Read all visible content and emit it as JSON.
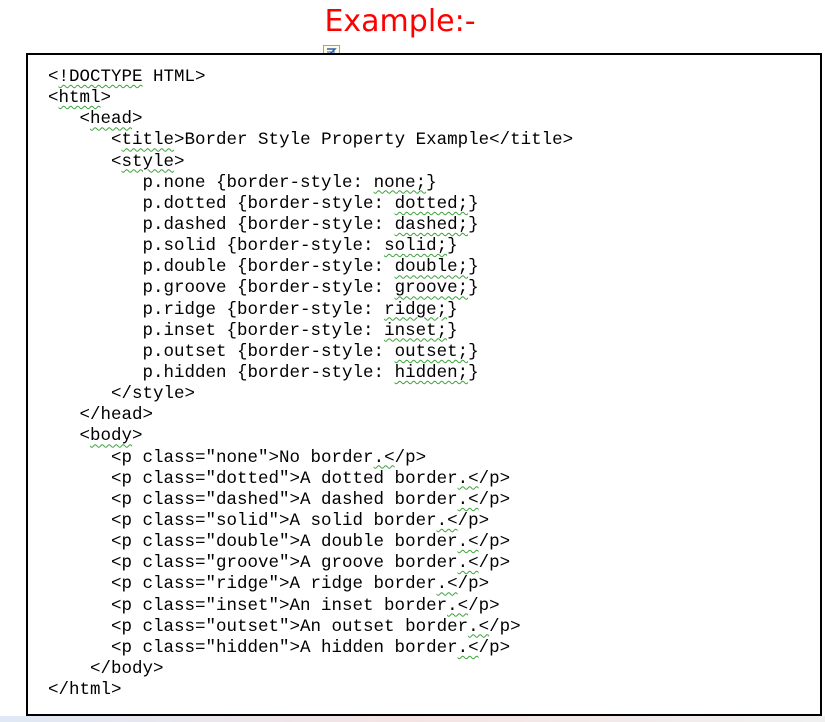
{
  "heading": "Example:-",
  "code_lines": [
    {
      "indent": "",
      "parts": [
        {
          "t": "<"
        },
        {
          "t": "!DOCTYPE",
          "sq": true
        },
        {
          "t": " HTML>"
        }
      ]
    },
    {
      "indent": "",
      "parts": [
        {
          "t": "<"
        },
        {
          "t": "html",
          "sq": true
        },
        {
          "t": ">"
        }
      ]
    },
    {
      "indent": "   ",
      "parts": [
        {
          "t": "<"
        },
        {
          "t": "head",
          "sq": true
        },
        {
          "t": ">"
        }
      ]
    },
    {
      "indent": "      ",
      "parts": [
        {
          "t": "<"
        },
        {
          "t": "title",
          "sq": true
        },
        {
          "t": ">Border Style Property Example</title>"
        }
      ]
    },
    {
      "indent": "      ",
      "parts": [
        {
          "t": "<"
        },
        {
          "t": "style",
          "sq": true
        },
        {
          "t": ">"
        }
      ]
    },
    {
      "indent": "         ",
      "parts": [
        {
          "t": "p.none {border-style: "
        },
        {
          "t": "none;",
          "sq": true
        },
        {
          "t": "}"
        }
      ]
    },
    {
      "indent": "         ",
      "parts": [
        {
          "t": "p.dotted {border-style: "
        },
        {
          "t": "dotted;",
          "sq": true
        },
        {
          "t": "}"
        }
      ]
    },
    {
      "indent": "         ",
      "parts": [
        {
          "t": "p.dashed {border-style: "
        },
        {
          "t": "dashed;",
          "sq": true
        },
        {
          "t": "}"
        }
      ]
    },
    {
      "indent": "         ",
      "parts": [
        {
          "t": "p.solid {border-style: "
        },
        {
          "t": "solid;",
          "sq": true
        },
        {
          "t": "}"
        }
      ]
    },
    {
      "indent": "         ",
      "parts": [
        {
          "t": "p.double {border-style: "
        },
        {
          "t": "double;",
          "sq": true
        },
        {
          "t": "}"
        }
      ]
    },
    {
      "indent": "         ",
      "parts": [
        {
          "t": "p.groove {border-style: "
        },
        {
          "t": "groove;",
          "sq": true
        },
        {
          "t": "}"
        }
      ]
    },
    {
      "indent": "         ",
      "parts": [
        {
          "t": "p.ridge {border-style: "
        },
        {
          "t": "ridge;",
          "sq": true
        },
        {
          "t": "}"
        }
      ]
    },
    {
      "indent": "         ",
      "parts": [
        {
          "t": "p.inset {border-style: "
        },
        {
          "t": "inset;",
          "sq": true
        },
        {
          "t": "}"
        }
      ]
    },
    {
      "indent": "         ",
      "parts": [
        {
          "t": "p.outset {border-style: "
        },
        {
          "t": "outset;",
          "sq": true
        },
        {
          "t": "}"
        }
      ]
    },
    {
      "indent": "         ",
      "parts": [
        {
          "t": "p.hidden {border-style: "
        },
        {
          "t": "hidden;",
          "sq": true
        },
        {
          "t": "}"
        }
      ]
    },
    {
      "indent": "      ",
      "parts": [
        {
          "t": "</style>"
        }
      ]
    },
    {
      "indent": "   ",
      "parts": [
        {
          "t": "</head>"
        }
      ]
    },
    {
      "indent": "   ",
      "parts": [
        {
          "t": "<"
        },
        {
          "t": "body",
          "sq": true
        },
        {
          "t": ">"
        }
      ]
    },
    {
      "indent": "      ",
      "parts": [
        {
          "t": "<p class=\"none\">No border"
        },
        {
          "t": ".<",
          "sq": true
        },
        {
          "t": "/p>"
        }
      ]
    },
    {
      "indent": "      ",
      "parts": [
        {
          "t": "<p class=\"dotted\">A dotted border"
        },
        {
          "t": ".<",
          "sq": true
        },
        {
          "t": "/p>"
        }
      ]
    },
    {
      "indent": "      ",
      "parts": [
        {
          "t": "<p class=\"dashed\">A dashed border"
        },
        {
          "t": ".<",
          "sq": true
        },
        {
          "t": "/p>"
        }
      ]
    },
    {
      "indent": "      ",
      "parts": [
        {
          "t": "<p class=\"solid\">A solid border"
        },
        {
          "t": ".<",
          "sq": true
        },
        {
          "t": "/p>"
        }
      ]
    },
    {
      "indent": "      ",
      "parts": [
        {
          "t": "<p class=\"double\">A double border"
        },
        {
          "t": ".<",
          "sq": true
        },
        {
          "t": "/p>"
        }
      ]
    },
    {
      "indent": "      ",
      "parts": [
        {
          "t": "<p class=\"groove\">A groove border"
        },
        {
          "t": ".<",
          "sq": true
        },
        {
          "t": "/p>"
        }
      ]
    },
    {
      "indent": "      ",
      "parts": [
        {
          "t": "<p class=\"ridge\">A ridge border"
        },
        {
          "t": ".<",
          "sq": true
        },
        {
          "t": "/p>"
        }
      ]
    },
    {
      "indent": "      ",
      "parts": [
        {
          "t": "<p class=\"inset\">An inset border"
        },
        {
          "t": ".<",
          "sq": true
        },
        {
          "t": "/p>"
        }
      ]
    },
    {
      "indent": "      ",
      "parts": [
        {
          "t": "<p class=\"outset\">An outset border"
        },
        {
          "t": ".<",
          "sq": true
        },
        {
          "t": "/p>"
        }
      ]
    },
    {
      "indent": "      ",
      "parts": [
        {
          "t": "<p class=\"hidden\">A hidden border"
        },
        {
          "t": ".<",
          "sq": true
        },
        {
          "t": "/p>"
        }
      ]
    },
    {
      "indent": "    ",
      "parts": [
        {
          "t": "</body>"
        }
      ]
    },
    {
      "indent": "",
      "parts": [
        {
          "t": "</html>"
        }
      ]
    }
  ],
  "colors": {
    "heading": "#ff0000",
    "frame_border": "#000000",
    "spellcheck_squiggle": "#3aa13a"
  },
  "icons": {
    "anchor": "object-anchor-icon"
  }
}
